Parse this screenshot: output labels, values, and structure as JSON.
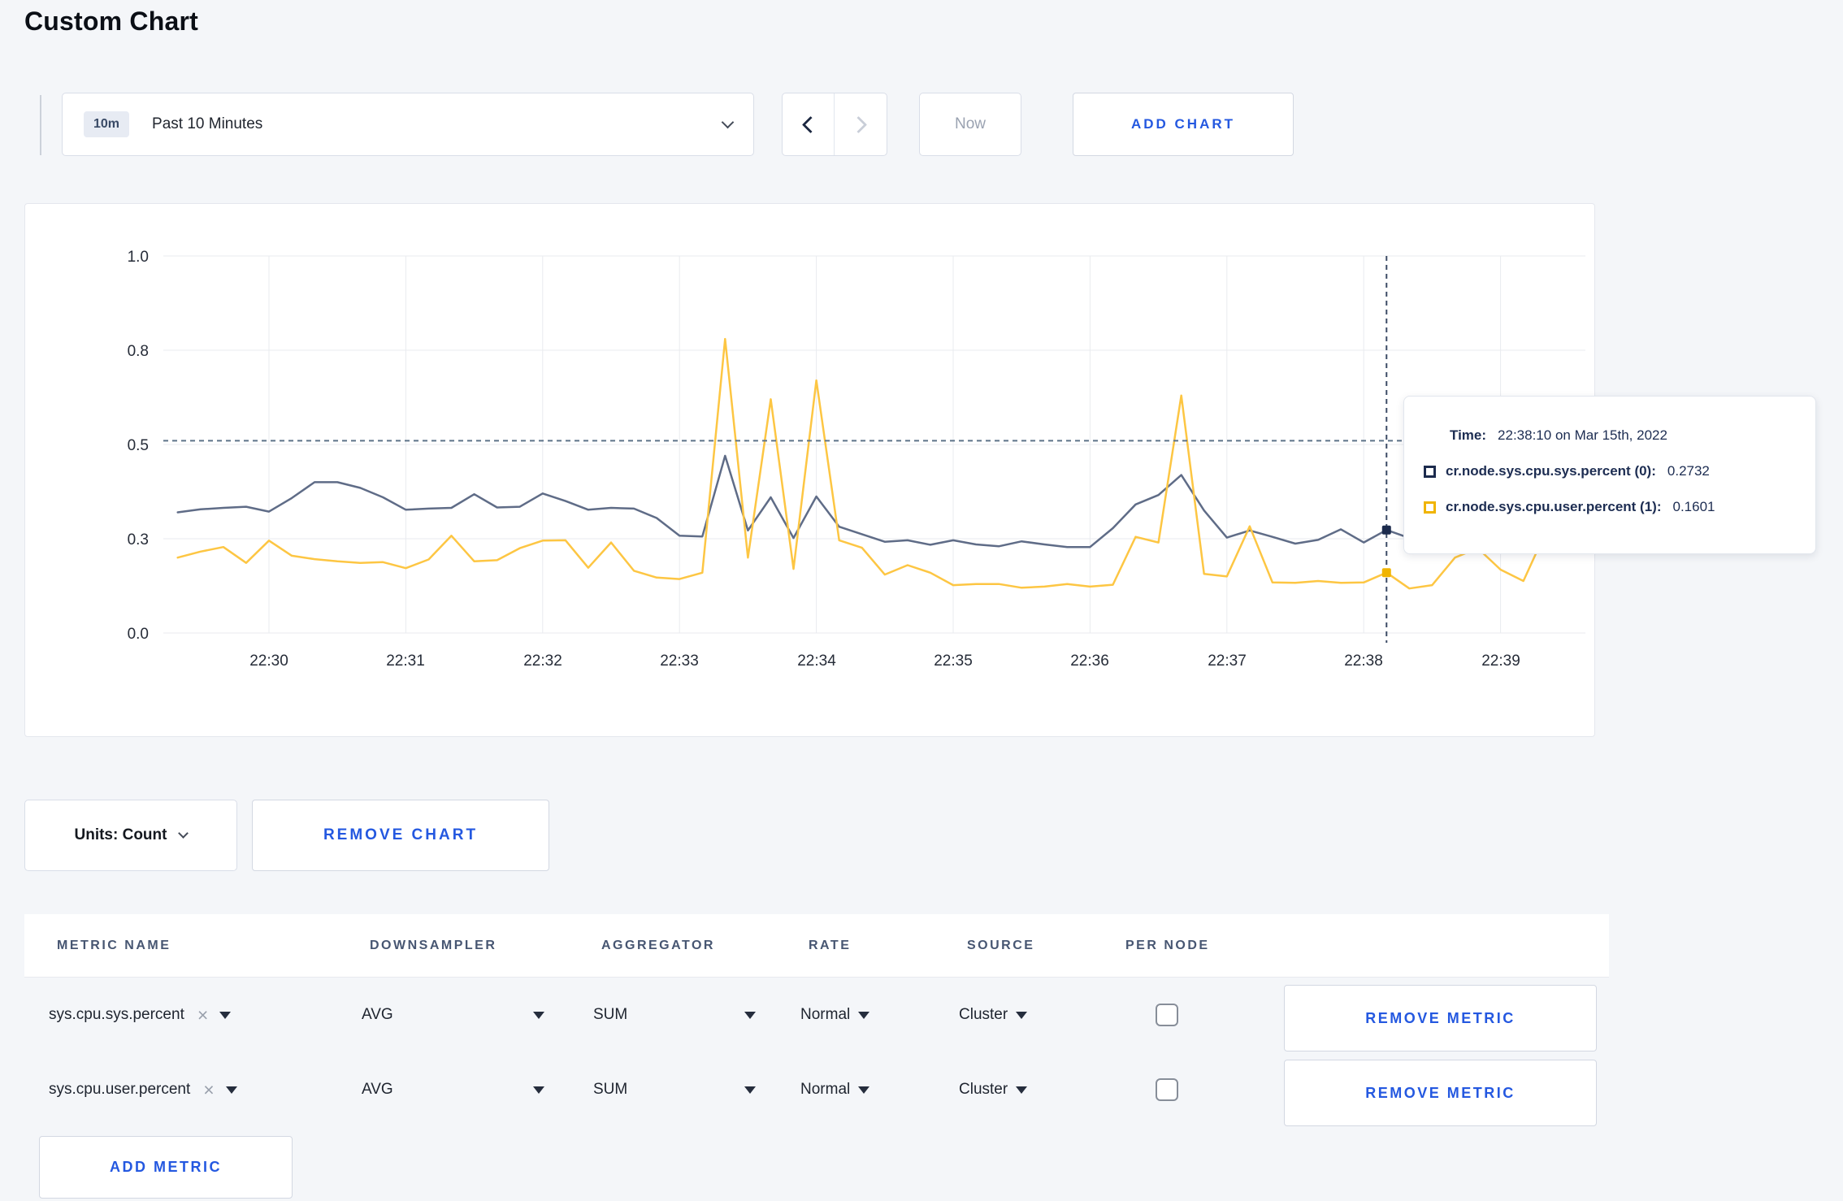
{
  "page": {
    "title": "Custom Chart",
    "background": "#f4f6f9",
    "accent_blue": "#2458e0"
  },
  "toolbar": {
    "time_window_badge": "10m",
    "time_window_label": "Past 10 Minutes",
    "now_label": "Now",
    "add_chart_label": "ADD CHART"
  },
  "chart_data": {
    "type": "line",
    "title": "",
    "xlabel": "",
    "ylabel": "",
    "grid": true,
    "grid_color": "#e9ebef",
    "x_axis": {
      "start_time": "22:29:20",
      "interval_seconds": 10,
      "tick_labels": [
        "22:30",
        "22:31",
        "22:32",
        "22:33",
        "22:34",
        "22:35",
        "22:36",
        "22:37",
        "22:38",
        "22:39"
      ]
    },
    "y_axis": {
      "range": [
        0,
        1.0
      ],
      "tick_values": [
        0,
        0.25,
        0.5,
        0.75,
        1.0
      ],
      "tick_labels": [
        "0.0",
        "0.3",
        "0.5",
        "0.8",
        "1.0"
      ]
    },
    "series": [
      {
        "name": "cr.node.sys.cpu.sys.percent (0)",
        "color": "#5f6c87",
        "highlight_color": "#1c2b4d",
        "values": [
          0.32,
          0.328,
          0.332,
          0.335,
          0.322,
          0.358,
          0.4,
          0.4,
          0.385,
          0.36,
          0.327,
          0.33,
          0.332,
          0.368,
          0.333,
          0.335,
          0.37,
          0.35,
          0.327,
          0.332,
          0.33,
          0.305,
          0.258,
          0.256,
          0.47,
          0.272,
          0.36,
          0.252,
          0.362,
          0.282,
          0.262,
          0.242,
          0.246,
          0.234,
          0.246,
          0.235,
          0.23,
          0.243,
          0.235,
          0.228,
          0.228,
          0.278,
          0.341,
          0.366,
          0.419,
          0.325,
          0.253,
          0.272,
          0.255,
          0.237,
          0.247,
          0.275,
          0.24,
          0.2732,
          0.252,
          0.27,
          0.3,
          0.285,
          0.295,
          0.285,
          0.28
        ]
      },
      {
        "name": "cr.node.sys.cpu.user.percent (1)",
        "color": "#fdc643",
        "highlight_color": "#f0b400",
        "values": [
          0.2,
          0.216,
          0.228,
          0.186,
          0.245,
          0.205,
          0.196,
          0.19,
          0.186,
          0.188,
          0.172,
          0.195,
          0.258,
          0.19,
          0.193,
          0.225,
          0.245,
          0.246,
          0.173,
          0.24,
          0.165,
          0.147,
          0.143,
          0.16,
          0.78,
          0.2,
          0.62,
          0.17,
          0.67,
          0.246,
          0.226,
          0.155,
          0.18,
          0.16,
          0.127,
          0.13,
          0.13,
          0.12,
          0.123,
          0.13,
          0.123,
          0.128,
          0.255,
          0.24,
          0.63,
          0.157,
          0.15,
          0.283,
          0.134,
          0.133,
          0.138,
          0.133,
          0.134,
          0.1601,
          0.118,
          0.127,
          0.2,
          0.225,
          0.168,
          0.138,
          0.27
        ]
      }
    ],
    "crosshair": {
      "time": "22:38:10",
      "index": 53,
      "line_color": "#3d4c66",
      "hline_value": 0.51,
      "hline_color": "#5d7389"
    },
    "legend_position": "tooltip"
  },
  "tooltip": {
    "time_label": "Time:",
    "time_value": "22:38:10 on Mar 15th, 2022",
    "rows": [
      {
        "label": "cr.node.sys.cpu.sys.percent (0):",
        "value": "0.2732",
        "color": "#1c2b4d"
      },
      {
        "label": "cr.node.sys.cpu.user.percent (1):",
        "value": "0.1601",
        "color": "#f0b400"
      }
    ]
  },
  "chart_controls": {
    "units_label": "Units: Count",
    "remove_chart_label": "REMOVE CHART"
  },
  "metrics_table": {
    "headers": [
      "METRIC NAME",
      "DOWNSAMPLER",
      "AGGREGATOR",
      "RATE",
      "SOURCE",
      "PER NODE"
    ],
    "remove_metric_label": "REMOVE METRIC",
    "add_metric_label": "ADD METRIC",
    "rows": [
      {
        "metric": "sys.cpu.sys.percent",
        "clear_icon": "×",
        "downsampler": "AVG",
        "aggregator": "SUM",
        "rate": "Normal",
        "source": "Cluster",
        "per_node_checked": false
      },
      {
        "metric": "sys.cpu.user.percent",
        "clear_icon": "×",
        "downsampler": "AVG",
        "aggregator": "SUM",
        "rate": "Normal",
        "source": "Cluster",
        "per_node_checked": false
      }
    ]
  }
}
